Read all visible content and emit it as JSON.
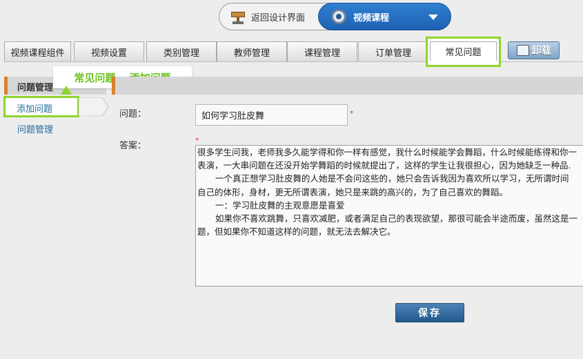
{
  "topbar": {
    "back_label": "返回设计界面",
    "course_label": "视频课程"
  },
  "tabs": [
    {
      "label": "视频课程组件"
    },
    {
      "label": "视频设置"
    },
    {
      "label": "类别管理"
    },
    {
      "label": "教师管理"
    },
    {
      "label": "课程管理"
    },
    {
      "label": "订单管理"
    },
    {
      "label": "常见问题"
    }
  ],
  "uninstall_label": "卸载",
  "callout": "常见问题 —添加问题",
  "sidebar": {
    "header": "问题管理",
    "items": [
      {
        "label": "添加问题"
      },
      {
        "label": "问题管理"
      }
    ]
  },
  "form": {
    "question_label": "问题：",
    "question_value": "如何学习肚皮舞",
    "required_mark": "*",
    "answer_label": "答案：",
    "answer_lines": [
      "很多学生问我，老师我多久能学得和你一样有感觉，我什么时候能学会舞蹈，什么时候能练得和你一",
      "表演，一大串问题在还没开始学舞蹈的时候就提出了，这样的学生让我很担心，因为她缺乏一种品.",
      "一个真正想学习肚皮舞的人她是不会问这些的，她只会告诉我因为喜欢所以学习，无所谓时间",
      "自己的体形，身材，更无所谓表演，她只是来跳的高兴的，为了自己喜欢的舞蹈。",
      "一：学习肚皮舞的主观意愿是喜爱",
      "如果你不喜欢跳舞，只喜欢减肥，或者满足自己的表现欲望，那很可能会半途而废，虽然这是一",
      "题，但如果你不知道这样的问题，就无法去解决它。"
    ],
    "save_label": "保存"
  }
}
